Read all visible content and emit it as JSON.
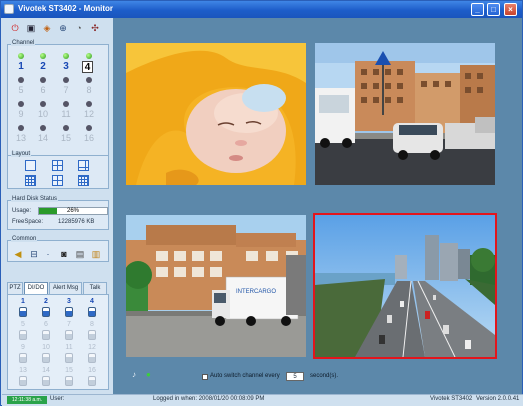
{
  "window": {
    "title": "Vivotek ST3402 - Monitor"
  },
  "toolbar": {
    "icons": [
      "power-icon",
      "monitor-icon",
      "palette-icon",
      "globe-icon",
      "clock-icon",
      "tools-icon"
    ]
  },
  "channel": {
    "title": "Channel",
    "items": [
      {
        "num": "1",
        "active": true
      },
      {
        "num": "2",
        "active": true
      },
      {
        "num": "3",
        "active": true
      },
      {
        "num": "4",
        "active": true,
        "selected": true
      },
      {
        "num": "5",
        "active": false
      },
      {
        "num": "6",
        "active": false
      },
      {
        "num": "7",
        "active": false
      },
      {
        "num": "8",
        "active": false
      },
      {
        "num": "9",
        "active": false
      },
      {
        "num": "10",
        "active": false
      },
      {
        "num": "11",
        "active": false
      },
      {
        "num": "12",
        "active": false
      },
      {
        "num": "13",
        "active": false
      },
      {
        "num": "14",
        "active": false
      },
      {
        "num": "15",
        "active": false
      },
      {
        "num": "16",
        "active": false
      }
    ]
  },
  "layout": {
    "title": "Layout"
  },
  "hdd": {
    "title": "Hard Disk Status",
    "usage_label": "Usage:",
    "usage_percent": 26,
    "usage_text": "26%",
    "freespace_label": "FreeSpace:",
    "freespace_value": "12285976 KB"
  },
  "common": {
    "title": "Common"
  },
  "tabs": [
    {
      "label": "PTZ",
      "active": false
    },
    {
      "label": "DI/DO",
      "active": true
    },
    {
      "label": "Alert Msg",
      "active": false
    },
    {
      "label": "Talk",
      "active": false
    }
  ],
  "dio": {
    "items": [
      {
        "num": "1",
        "active": true
      },
      {
        "num": "2",
        "active": true
      },
      {
        "num": "3",
        "active": true
      },
      {
        "num": "4",
        "active": true
      },
      {
        "num": "5",
        "active": false
      },
      {
        "num": "6",
        "active": false
      },
      {
        "num": "7",
        "active": false
      },
      {
        "num": "8",
        "active": false
      },
      {
        "num": "9",
        "active": false
      },
      {
        "num": "10",
        "active": false
      },
      {
        "num": "11",
        "active": false
      },
      {
        "num": "12",
        "active": false
      },
      {
        "num": "13",
        "active": false
      },
      {
        "num": "14",
        "active": false
      },
      {
        "num": "15",
        "active": false
      },
      {
        "num": "16",
        "active": false
      }
    ]
  },
  "auto_switch": {
    "label": "Auto switch channel every",
    "value": "5",
    "unit": "second(s)."
  },
  "status": {
    "clock": "12:11:38 a.m.",
    "user_label": "User:",
    "login": "Logged in when: 2008/01/20 00:08:09 PM",
    "product": "Vivotek ST3402",
    "version": "Version 2.0.0.41"
  },
  "colors": {
    "accent": "#1d5dc9",
    "selected_border": "#e3151c",
    "video_bg": "#5c88aa"
  }
}
